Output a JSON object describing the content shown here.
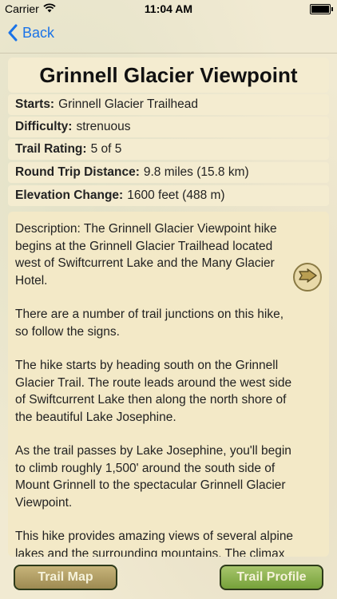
{
  "status_bar": {
    "carrier": "Carrier",
    "time": "11:04 AM",
    "battery_level": 1.0
  },
  "nav": {
    "back_label": "Back"
  },
  "trail": {
    "title": "Grinnell Glacier Viewpoint",
    "rows": [
      {
        "label": "Starts:",
        "value": "Grinnell Glacier Trailhead"
      },
      {
        "label": "Difficulty:",
        "value": "strenuous"
      },
      {
        "label": "Trail Rating:",
        "value": "5 of 5"
      },
      {
        "label": "Round Trip Distance:",
        "value": "9.8 miles (15.8 km)"
      },
      {
        "label": "Elevation Change:",
        "value": "1600 feet (488 m)"
      }
    ],
    "description": [
      "Description: The Grinnell Glacier Viewpoint hike begins at the Grinnell Glacier Trailhead located west of Swiftcurrent Lake and the Many Glacier Hotel.",
      "There are a number of trail junctions on this hike, so follow the signs.",
      "The hike starts by heading south on the Grinnell Glacier Trail. The route leads around the west side of Swiftcurrent Lake then along the north shore of the beautiful Lake Josephine.",
      "As the trail passes by Lake Josephine, you'll begin to climb roughly 1,500' around the south side of Mount Grinnell to the spectacular Grinnell Glacier Viewpoint.",
      "This hike provides amazing views of several alpine lakes and the surrounding mountains. The climax of the hike is the view of Upper Grinnell Lake and Grinnell Glacier."
    ]
  },
  "buttons": {
    "trail_map": "Trail Map",
    "trail_profile": "Trail Profile"
  }
}
